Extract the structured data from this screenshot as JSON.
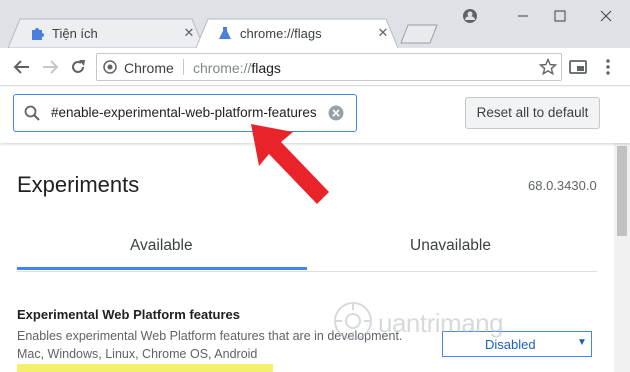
{
  "tabs": [
    {
      "title": "Tiện ích",
      "active": false
    },
    {
      "title": "chrome://flags",
      "active": true
    }
  ],
  "toolbar": {
    "site_chip": "Chrome",
    "url_scheme": "chrome://",
    "url_path": "flags"
  },
  "flags": {
    "search_query": "#enable-experimental-web-platform-features",
    "reset_label": "Reset all to default",
    "page_title": "Experiments",
    "version": "68.0.3430.0",
    "tab_available": "Available",
    "tab_unavailable": "Unavailable",
    "experiment": {
      "title": "Experimental Web Platform features",
      "description": "Enables experimental Web Platform features that are in development.",
      "platforms": "Mac, Windows, Linux, Chrome OS, Android",
      "selected": "Disabled"
    }
  },
  "watermark": "uantrimang",
  "colors": {
    "accent": "#4285f4",
    "tabstrip": "#dee1e6",
    "highlight": "#f4f06a",
    "arrow": "#e8232a"
  },
  "icons": [
    "puzzle-icon",
    "flask-icon",
    "close-icon",
    "minimize-icon",
    "maximize-icon",
    "back-icon",
    "forward-icon",
    "reload-icon",
    "chrome-logo-icon",
    "star-icon",
    "cast-icon",
    "menu-icon",
    "search-icon",
    "clear-icon",
    "dropdown-arrow-icon"
  ]
}
